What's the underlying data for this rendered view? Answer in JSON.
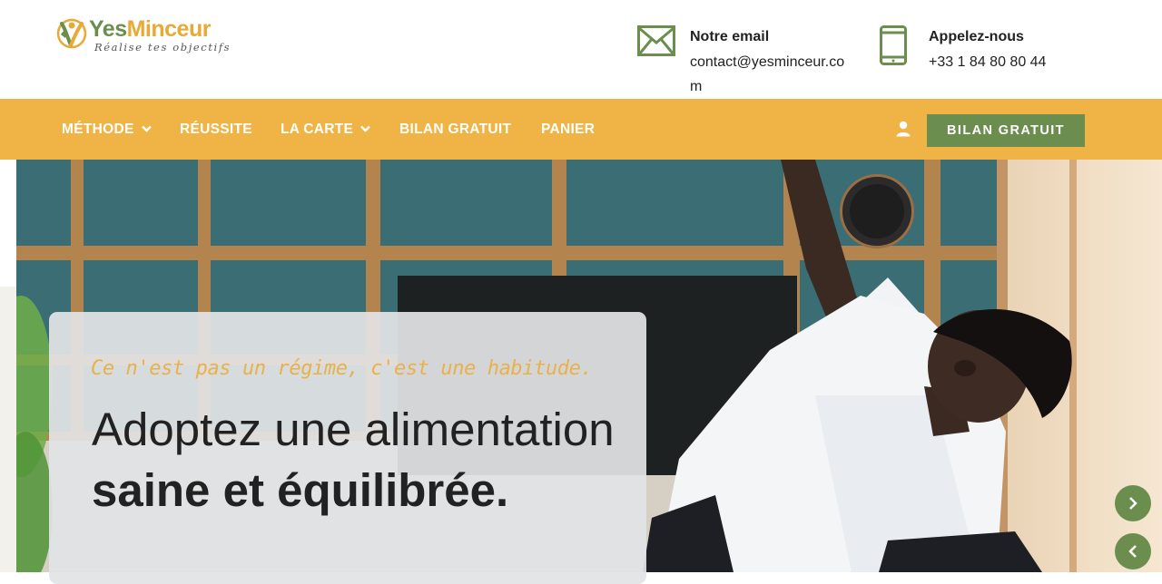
{
  "brand": {
    "name_part1": "Yes",
    "name_part2": "Minceur",
    "tagline": "Réalise tes objectifs",
    "colors": {
      "green": "#6b8e4e",
      "orange": "#efb445",
      "kicker": "#eab14a"
    }
  },
  "contact": {
    "email": {
      "title": "Notre email",
      "value": "contact@yesminceur.com",
      "icon": "envelope-icon"
    },
    "phone": {
      "title": "Appelez-nous",
      "value": "+33 1 84 80 80 44",
      "icon": "mobile-phone-icon"
    }
  },
  "nav": {
    "items": [
      {
        "label": "MÉTHODE",
        "has_dropdown": true
      },
      {
        "label": "RÉUSSITE",
        "has_dropdown": false
      },
      {
        "label": "LA CARTE",
        "has_dropdown": true
      },
      {
        "label": "BILAN GRATUIT",
        "has_dropdown": false
      },
      {
        "label": "PANIER",
        "has_dropdown": false
      }
    ],
    "account_icon": "user-icon",
    "cta_label": "BILAN GRATUIT"
  },
  "hero": {
    "kicker": "Ce n'est pas un régime, c'est une habitude.",
    "headline_regular": "Adoptez une alimentation ",
    "headline_bold": "saine et équilibrée.",
    "next_icon": "chevron-right-icon",
    "prev_icon": "chevron-left-icon"
  }
}
